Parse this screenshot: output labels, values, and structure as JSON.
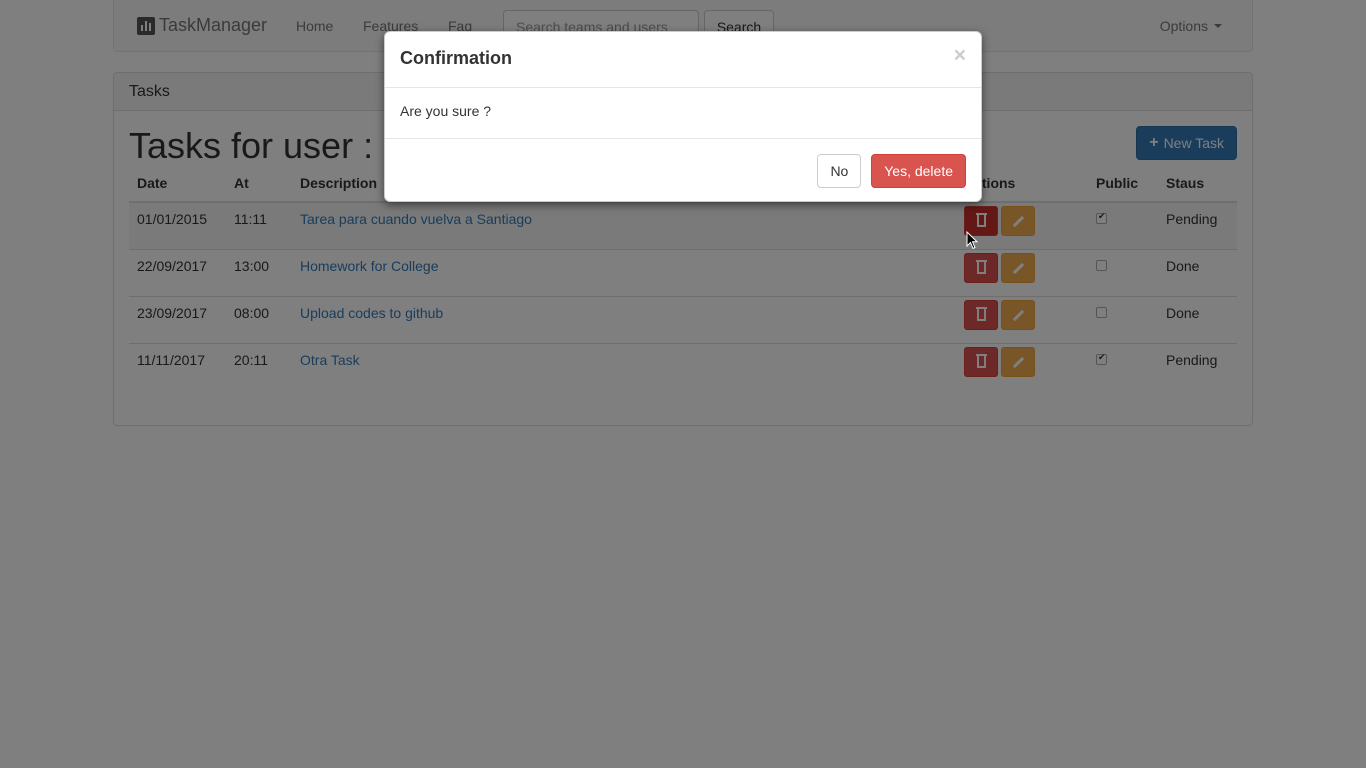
{
  "navbar": {
    "brand": "TaskManager",
    "links": [
      "Home",
      "Features",
      "Faq"
    ],
    "search_placeholder": "Search teams and users",
    "search_button": "Search",
    "options": "Options"
  },
  "panel": {
    "heading": "Tasks",
    "title": "Tasks for user :",
    "new_task_button": "New Task"
  },
  "table": {
    "headers": [
      "Date",
      "At",
      "Description",
      "Actions",
      "Public",
      "Staus"
    ],
    "rows": [
      {
        "date": "01/01/2015",
        "at": "11:11",
        "description": "Tarea para cuando vuelva a Santiago",
        "public": true,
        "status": "Pending"
      },
      {
        "date": "22/09/2017",
        "at": "13:00",
        "description": "Homework for College",
        "public": false,
        "status": "Done"
      },
      {
        "date": "23/09/2017",
        "at": "08:00",
        "description": "Upload codes to github",
        "public": false,
        "status": "Done"
      },
      {
        "date": "11/11/2017",
        "at": "20:11",
        "description": "Otra Task",
        "public": true,
        "status": "Pending"
      }
    ]
  },
  "modal": {
    "title": "Confirmation",
    "close": "×",
    "body": "Are you sure ?",
    "no_button": "No",
    "yes_button": "Yes, delete"
  },
  "colors": {
    "primary": "#337ab7",
    "danger": "#d9534f",
    "warning": "#f0ad4e"
  }
}
